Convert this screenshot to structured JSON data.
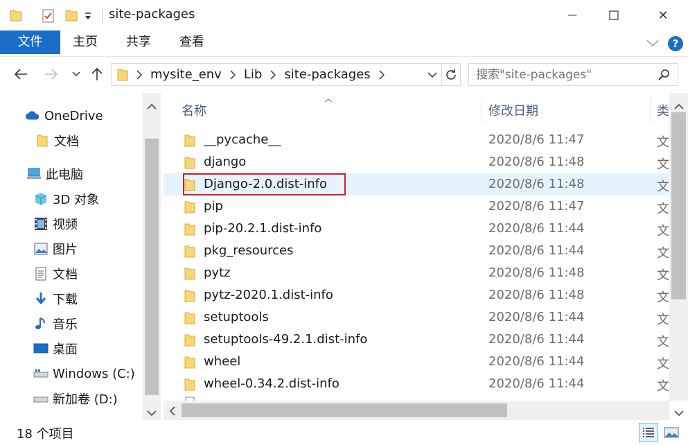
{
  "window": {
    "title": "site-packages",
    "minimize_glyph": "—",
    "close_glyph": "✕"
  },
  "ribbon": {
    "tabs": [
      {
        "label": "文件"
      },
      {
        "label": "主页"
      },
      {
        "label": "共享"
      },
      {
        "label": "查看"
      }
    ]
  },
  "address": {
    "segments": [
      "mysite_env",
      "Lib",
      "site-packages"
    ]
  },
  "search": {
    "placeholder": "搜索\"site-packages\""
  },
  "sidebar": {
    "items": [
      {
        "label": "OneDrive",
        "icon": "cloud-icon"
      },
      {
        "label": "文档",
        "icon": "folder-icon"
      },
      {
        "label": "此电脑",
        "icon": "computer-icon"
      },
      {
        "label": "3D 对象",
        "icon": "cube-icon"
      },
      {
        "label": "视频",
        "icon": "video-icon"
      },
      {
        "label": "图片",
        "icon": "picture-icon"
      },
      {
        "label": "文档",
        "icon": "document-icon"
      },
      {
        "label": "下载",
        "icon": "download-icon"
      },
      {
        "label": "音乐",
        "icon": "music-icon"
      },
      {
        "label": "桌面",
        "icon": "desktop-icon"
      },
      {
        "label": "Windows (C:)",
        "icon": "drive-icon"
      },
      {
        "label": "新加卷 (D:)",
        "icon": "drive-icon"
      }
    ]
  },
  "list": {
    "columns": {
      "name": "名称",
      "date": "修改日期",
      "type": "类"
    },
    "rows": [
      {
        "name": "__pycache__",
        "date": "2020/8/6 11:47",
        "type": "文"
      },
      {
        "name": "django",
        "date": "2020/8/6 11:48",
        "type": "文"
      },
      {
        "name": "Django-2.0.dist-info",
        "date": "2020/8/6 11:48",
        "type": "文"
      },
      {
        "name": "pip",
        "date": "2020/8/6 11:47",
        "type": "文"
      },
      {
        "name": "pip-20.2.1.dist-info",
        "date": "2020/8/6 11:44",
        "type": "文"
      },
      {
        "name": "pkg_resources",
        "date": "2020/8/6 11:44",
        "type": "文"
      },
      {
        "name": "pytz",
        "date": "2020/8/6 11:48",
        "type": "文"
      },
      {
        "name": "pytz-2020.1.dist-info",
        "date": "2020/8/6 11:48",
        "type": "文"
      },
      {
        "name": "setuptools",
        "date": "2020/8/6 11:44",
        "type": "文"
      },
      {
        "name": "setuptools-49.2.1.dist-info",
        "date": "2020/8/6 11:44",
        "type": "文"
      },
      {
        "name": "wheel",
        "date": "2020/8/6 11:44",
        "type": "文"
      },
      {
        "name": "wheel-0.34.2.dist-info",
        "date": "2020/8/6 11:44",
        "type": "文"
      }
    ]
  },
  "status": {
    "item_count": "18 个项目"
  },
  "colors": {
    "accent": "#1a6ec7",
    "folder": "#f8d775",
    "selection": "#e5f3ff",
    "highlight_border": "#d0202a"
  }
}
